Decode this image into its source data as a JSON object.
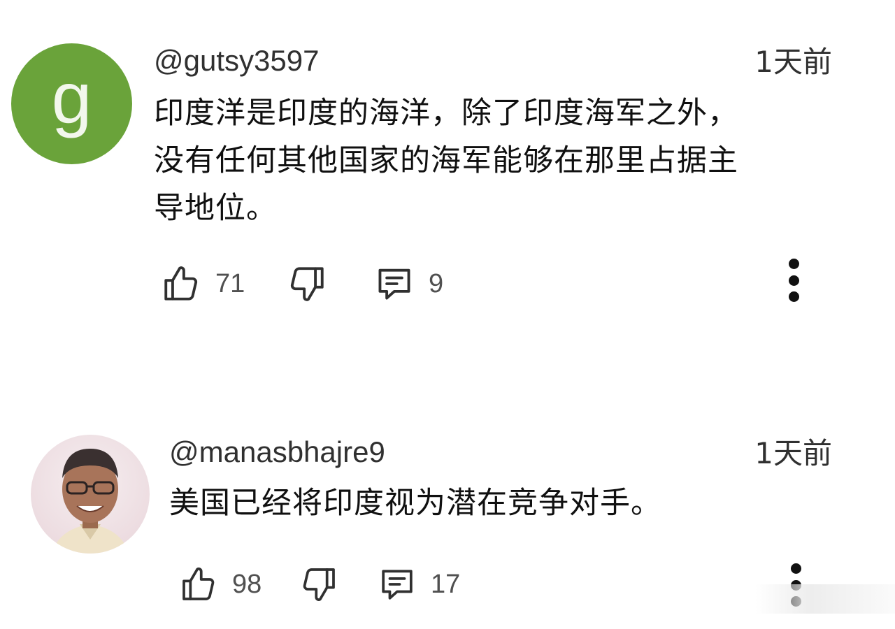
{
  "comments": [
    {
      "avatar_letter": "g",
      "avatar_color": "#6aa33a",
      "handle": "@gutsy3597",
      "time": "1天前",
      "text_lines": [
        "印度洋是印度的海洋，除了印度海军之外，",
        "没有任何其他国家的海军能够在那里占据主",
        "导地位。"
      ],
      "likes": "71",
      "replies": "9"
    },
    {
      "avatar_letter": "",
      "avatar_color": "#f3e6e8",
      "handle": "@manasbhajre9",
      "time": "1天前",
      "text_lines": [
        "美国已经将印度视为潜在竞争对手。"
      ],
      "likes": "98",
      "replies": "17"
    }
  ],
  "icons": {
    "like": "thumbs-up-icon",
    "dislike": "thumbs-down-icon",
    "reply": "comment-icon",
    "more": "more-vertical-icon"
  }
}
